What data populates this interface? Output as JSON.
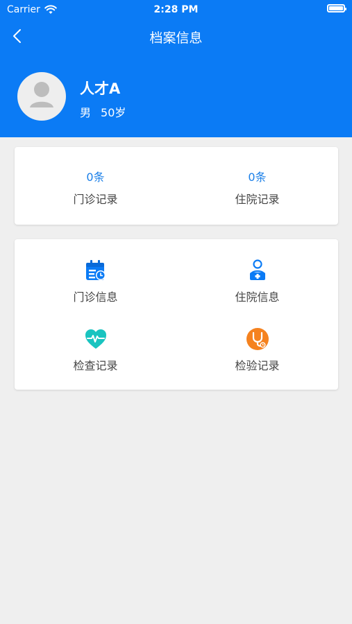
{
  "status_bar": {
    "carrier": "Carrier",
    "time": "2:28 PM"
  },
  "nav": {
    "title": "档案信息",
    "back_icon": "chevron-left-icon"
  },
  "profile": {
    "name": "人才A",
    "gender": "男",
    "age": "50岁",
    "avatar_icon": "person-icon"
  },
  "stats": [
    {
      "value": "0条",
      "label": "门诊记录"
    },
    {
      "value": "0条",
      "label": "住院记录"
    }
  ],
  "menu": [
    {
      "label": "门诊信息",
      "icon": "calendar-clock-icon"
    },
    {
      "label": "住院信息",
      "icon": "inpatient-icon"
    },
    {
      "label": "检查记录",
      "icon": "heartbeat-icon"
    },
    {
      "label": "检验记录",
      "icon": "stethoscope-icon"
    }
  ],
  "colors": {
    "primary": "#0b7bf5",
    "background": "#efefef",
    "value_blue": "#1a7fe8",
    "teal": "#19c4c0",
    "orange": "#f5821f"
  }
}
